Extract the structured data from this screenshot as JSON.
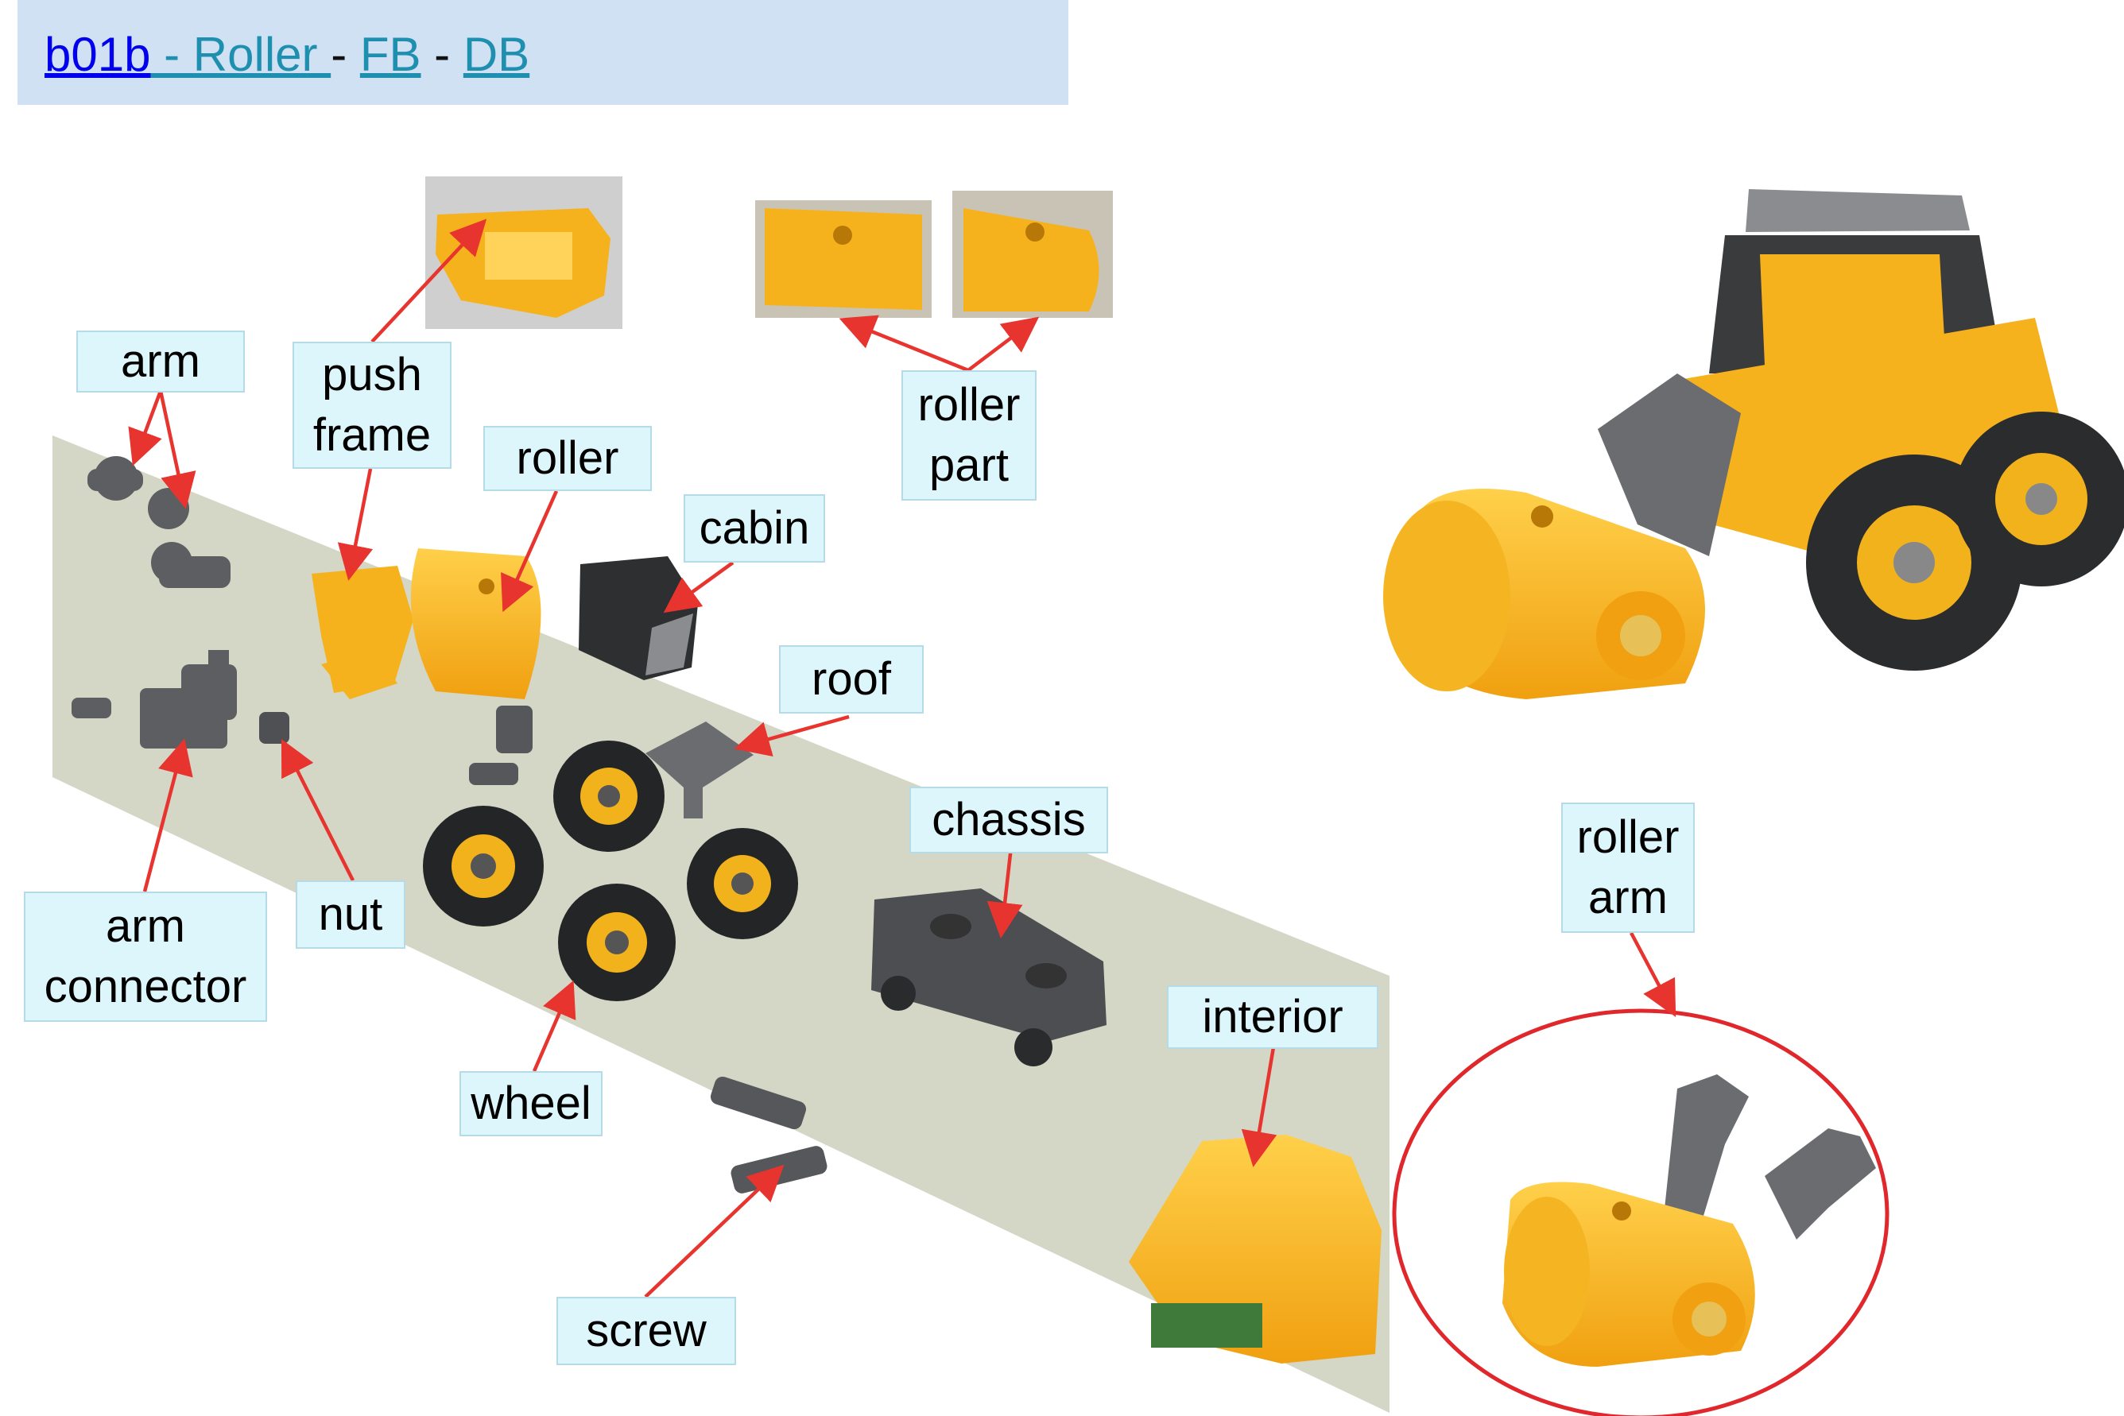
{
  "header": {
    "link_code": "b01b",
    "link_name": " - Roller  ",
    "sep1": " - ",
    "link_fb": "FB",
    "sep2": "  - ",
    "link_db": "DB"
  },
  "labels": {
    "arm": "arm",
    "push_frame": "push\nframe",
    "roller": "roller",
    "roller_part": "roller\npart",
    "cabin": "cabin",
    "roof": "roof",
    "chassis": "chassis",
    "arm_connector": "arm\nconnector",
    "nut": "nut",
    "wheel": "wheel",
    "interior": "interior",
    "screw": "screw",
    "roller_arm": "roller\narm"
  },
  "colors": {
    "header_bg": "#cfe1f3",
    "label_bg": "#dcf6fb",
    "arrow": "#e8342f",
    "part_yellow": "#f6b21c",
    "part_gray": "#5c5e61",
    "background_mat": "#d4d6c6",
    "circle": "#e0282c"
  },
  "icons": [
    "roller-toy-assembled",
    "roller-arm-assembly",
    "push-frame-photo",
    "roller-part-photo"
  ]
}
